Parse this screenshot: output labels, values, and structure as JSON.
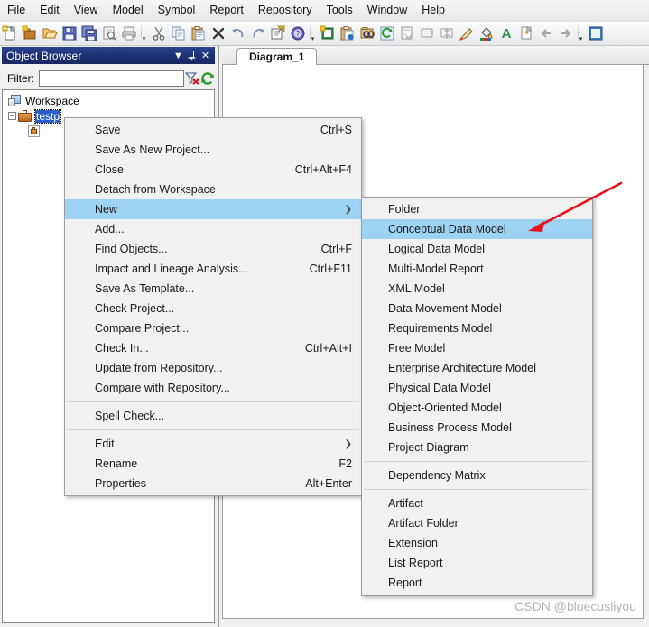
{
  "menubar": {
    "items": [
      {
        "label": "File"
      },
      {
        "label": "Edit"
      },
      {
        "label": "View"
      },
      {
        "label": "Model"
      },
      {
        "label": "Symbol"
      },
      {
        "label": "Report"
      },
      {
        "label": "Repository"
      },
      {
        "label": "Tools"
      },
      {
        "label": "Window"
      },
      {
        "label": "Help"
      }
    ]
  },
  "toolbar": {
    "groups": [
      {
        "buttons": [
          {
            "icon": "new-document-icon"
          },
          {
            "icon": "new-package-icon"
          },
          {
            "icon": "open-folder-icon"
          },
          {
            "icon": "save-icon"
          },
          {
            "icon": "save-all-icon"
          },
          {
            "icon": "print-preview-icon"
          },
          {
            "icon": "print-icon"
          }
        ]
      },
      {
        "buttons": [
          {
            "icon": "cut-icon"
          },
          {
            "icon": "copy-icon"
          },
          {
            "icon": "paste-icon"
          },
          {
            "icon": "delete-icon"
          },
          {
            "icon": "undo-icon"
          },
          {
            "icon": "redo-icon"
          },
          {
            "icon": "properties-icon"
          },
          {
            "icon": "help-icon"
          }
        ]
      },
      {
        "buttons": [
          {
            "icon": "new-diagram-icon"
          },
          {
            "icon": "paste-special-icon"
          },
          {
            "icon": "find-objects-icon"
          },
          {
            "icon": "refresh-icon"
          },
          {
            "icon": "check-model-icon"
          },
          {
            "icon": "shape-icon"
          },
          {
            "icon": "align-icon"
          },
          {
            "icon": "format-brush-icon"
          },
          {
            "icon": "fill-color-icon"
          },
          {
            "icon": "font-color-icon"
          },
          {
            "icon": "export-icon"
          },
          {
            "icon": "previous-icon"
          },
          {
            "icon": "next-icon"
          }
        ]
      },
      {
        "buttons": [
          {
            "icon": "panel-icon"
          }
        ]
      }
    ],
    "overflow_glyph": "▾"
  },
  "object_browser": {
    "title": "Object Browser",
    "title_buttons": [
      {
        "icon": "chevron-down-icon",
        "glyph": "▼"
      },
      {
        "icon": "pin-icon",
        "glyph": "⌸"
      },
      {
        "icon": "close-icon",
        "glyph": "✕"
      }
    ],
    "filter": {
      "label": "Filter:",
      "value": "",
      "placeholder": "",
      "clear_icon": "clear-filter-icon",
      "refresh_icon": "refresh-icon"
    },
    "tree": [
      {
        "label": "Workspace",
        "icon": "workspace-icon",
        "depth": 0,
        "expander": "",
        "selected": false
      },
      {
        "label": "testp",
        "icon": "project-briefcase-icon",
        "depth": 1,
        "expander": "−",
        "selected": true
      },
      {
        "label": "",
        "icon": "project-item-icon",
        "depth": 2,
        "expander": "",
        "selected": false
      }
    ]
  },
  "document_area": {
    "tabs": [
      {
        "label": "Diagram_1",
        "active": true
      }
    ]
  },
  "context_menu": {
    "items": [
      {
        "label": "Save",
        "accel": "Ctrl+S",
        "type": "item"
      },
      {
        "label": "Save As New Project...",
        "accel": "",
        "type": "item"
      },
      {
        "label": "Close",
        "accel": "Ctrl+Alt+F4",
        "type": "item"
      },
      {
        "label": "Detach from Workspace",
        "accel": "",
        "type": "item"
      },
      {
        "label": "New",
        "accel": "",
        "type": "submenu",
        "arrow": "❯",
        "highlighted": true
      },
      {
        "label": "Add...",
        "accel": "",
        "type": "item"
      },
      {
        "label": "Find Objects...",
        "accel": "Ctrl+F",
        "type": "item"
      },
      {
        "label": "Impact and Lineage Analysis...",
        "accel": "Ctrl+F11",
        "type": "item"
      },
      {
        "label": "Save As Template...",
        "accel": "",
        "type": "item"
      },
      {
        "label": "Check Project...",
        "accel": "",
        "type": "item"
      },
      {
        "label": "Compare Project...",
        "accel": "",
        "type": "item"
      },
      {
        "label": "Check In...",
        "accel": "Ctrl+Alt+I",
        "type": "item"
      },
      {
        "label": "Update from Repository...",
        "accel": "",
        "type": "item"
      },
      {
        "label": "Compare with Repository...",
        "accel": "",
        "type": "item"
      },
      {
        "type": "separator"
      },
      {
        "label": "Spell Check...",
        "accel": "",
        "type": "item"
      },
      {
        "type": "separator"
      },
      {
        "label": "Edit",
        "accel": "",
        "type": "submenu",
        "arrow": "❯"
      },
      {
        "label": "Rename",
        "accel": "F2",
        "type": "item"
      },
      {
        "label": "Properties",
        "accel": "Alt+Enter",
        "type": "item"
      }
    ]
  },
  "new_submenu": {
    "items": [
      {
        "label": "Folder",
        "type": "item"
      },
      {
        "label": "Conceptual Data Model",
        "type": "item",
        "highlighted": true
      },
      {
        "label": "Logical Data Model",
        "type": "item"
      },
      {
        "label": "Multi-Model Report",
        "type": "item"
      },
      {
        "label": "XML Model",
        "type": "item"
      },
      {
        "label": "Data Movement Model",
        "type": "item"
      },
      {
        "label": "Requirements Model",
        "type": "item"
      },
      {
        "label": "Free Model",
        "type": "item"
      },
      {
        "label": "Enterprise Architecture Model",
        "type": "item"
      },
      {
        "label": "Physical Data Model",
        "type": "item"
      },
      {
        "label": "Object-Oriented Model",
        "type": "item"
      },
      {
        "label": "Business Process Model",
        "type": "item"
      },
      {
        "label": "Project Diagram",
        "type": "item"
      },
      {
        "type": "separator"
      },
      {
        "label": "Dependency Matrix",
        "type": "item"
      },
      {
        "type": "separator"
      },
      {
        "label": "Artifact",
        "type": "item"
      },
      {
        "label": "Artifact Folder",
        "type": "item"
      },
      {
        "label": "Extension",
        "type": "item"
      },
      {
        "label": "List Report",
        "type": "item"
      },
      {
        "label": "Report",
        "type": "item"
      }
    ]
  },
  "annotation": {
    "arrow_color": "#e8101a",
    "name": "red-pointer-arrow"
  },
  "watermark": {
    "text": "CSDN @bluecusliyou"
  },
  "colors": {
    "panel_title_bg": "#1c3173",
    "menu_highlight": "#9ed2f2",
    "tree_selection": "#2a5fc8",
    "menu_bg": "#f1f1f1",
    "toolbar_bg": "#eceef0"
  }
}
